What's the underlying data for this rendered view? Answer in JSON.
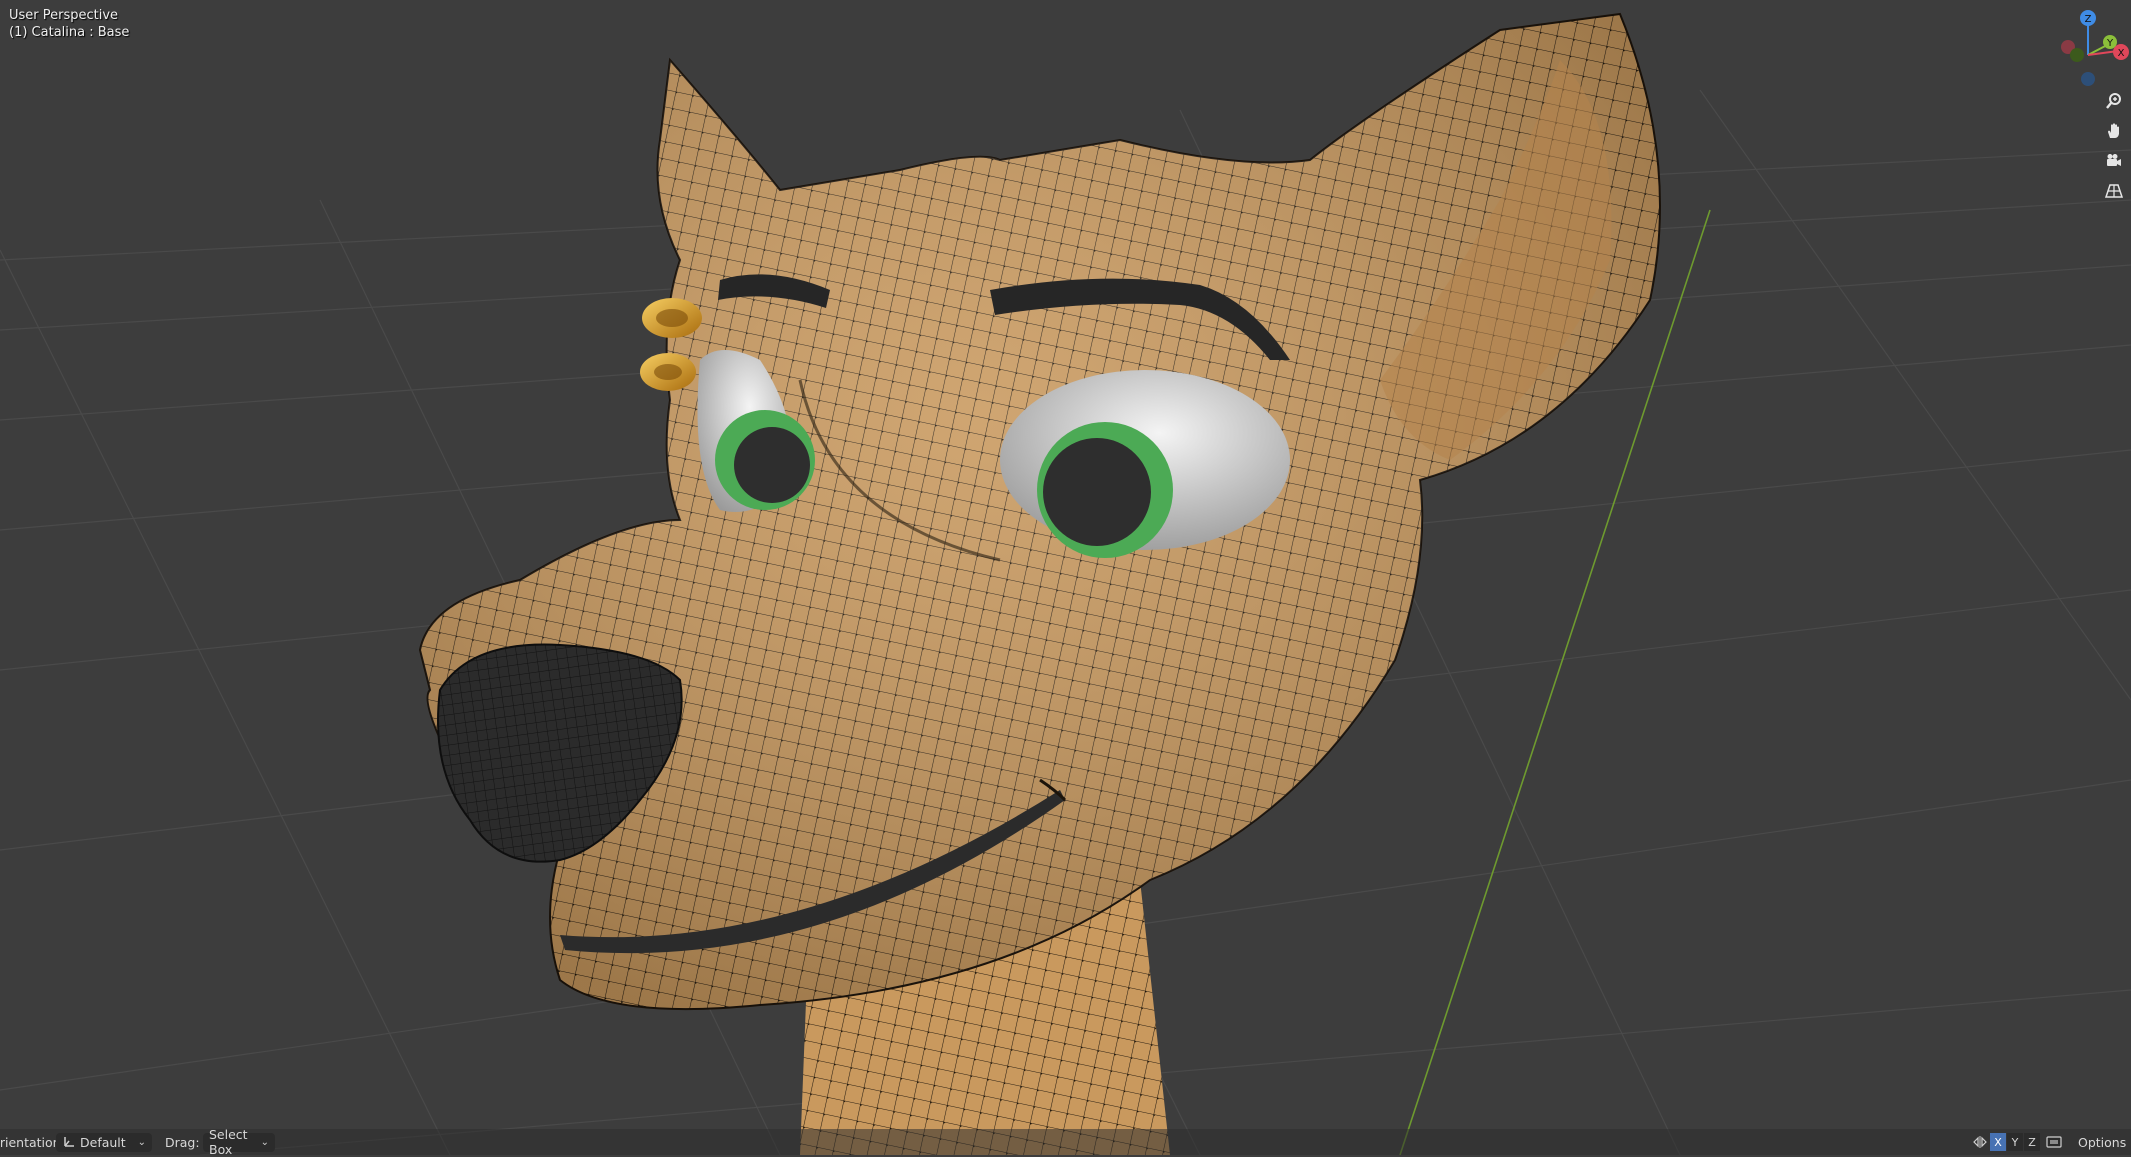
{
  "viewport": {
    "view_name": "User Perspective",
    "object_info": "(1) Catalina : Base"
  },
  "gizmo": {
    "axis_z": "Z",
    "axis_y": "Y",
    "axis_x": "X",
    "colors": {
      "x": "#e0475a",
      "y": "#8bbf3a",
      "z": "#3f8ce6"
    }
  },
  "navigation": {
    "icons": [
      "zoom-icon",
      "hand-icon",
      "camera-icon",
      "grid-perspective-icon"
    ]
  },
  "status_bar": {
    "orientation_label": "Orientation:",
    "orientation_value": "Default",
    "drag_label": "Drag:",
    "drag_value": "Select Box",
    "axis_x": "X",
    "axis_y": "Y",
    "axis_z": "Z",
    "options_label": "Options"
  },
  "colors": {
    "background": "#3d3d3d",
    "skin": "#c9995e",
    "nose": "#2a2a2a",
    "iris": "#4caa55",
    "earring": "#d79a23"
  }
}
